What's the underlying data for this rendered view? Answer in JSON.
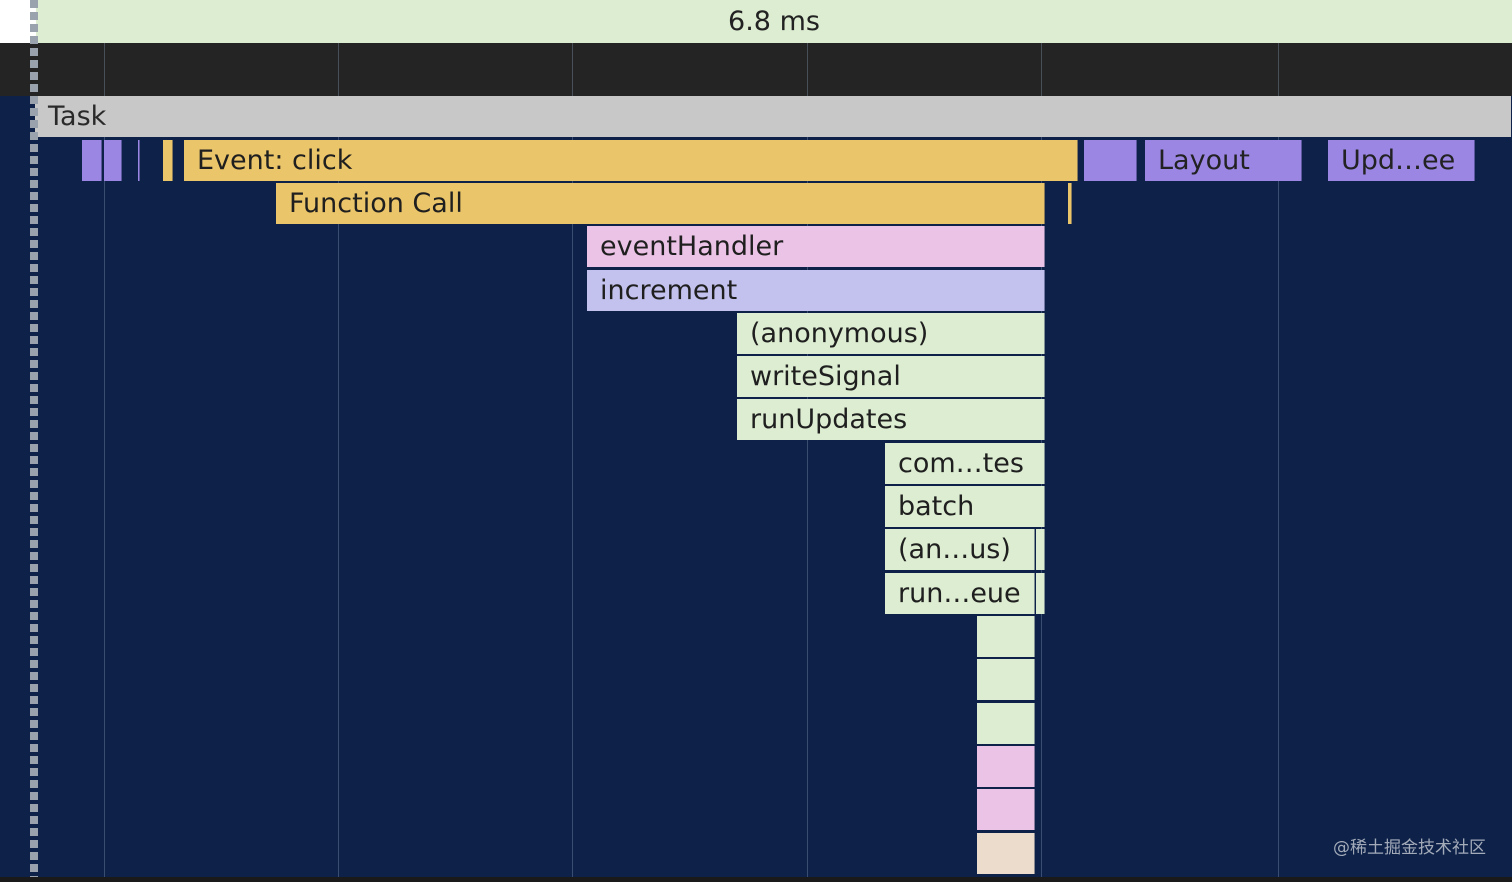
{
  "timeline": {
    "duration_label": "6.8 ms"
  },
  "flame": {
    "task": "Task",
    "event_click": "Event: click",
    "layout": "Layout",
    "update_tree": "Upd…ee",
    "function_call": "Function Call",
    "event_handler": "eventHandler",
    "increment": "increment",
    "anonymous": "(anonymous)",
    "write_signal": "writeSignal",
    "run_updates": "runUpdates",
    "complete_updates": "com…tes",
    "batch": "batch",
    "anonymous_short": "(an…us)",
    "run_queue": "run…eue"
  },
  "watermark": "@稀土掘金技术社区",
  "colors": {
    "background": "#0d2149",
    "task": "#c8c8c8",
    "event": "#ebc569",
    "render": "#9b86e4",
    "script_green": "#dcedd1",
    "script_pink": "#ebc3e6",
    "script_lavender": "#c3c2ee"
  }
}
